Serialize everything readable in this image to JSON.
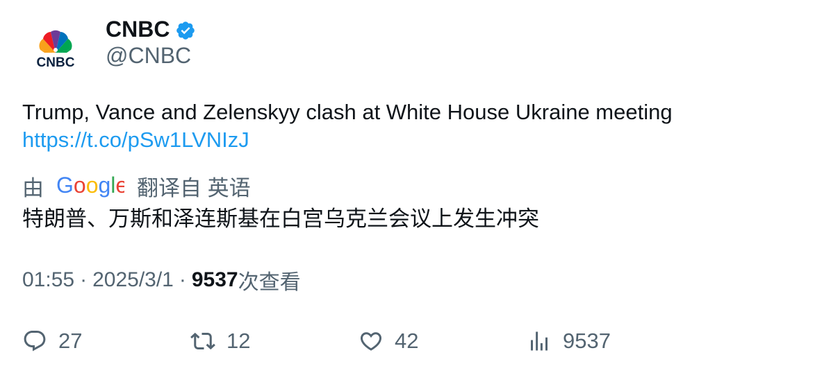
{
  "account": {
    "name": "CNBC",
    "handle": "@CNBC",
    "logo_text": "CNBC",
    "avatar_icon": "cnbc-peacock-logo",
    "verified_icon": "verified-badge-icon"
  },
  "tweet": {
    "text": "Trump, Vance and Zelenskyy clash at White House Ukraine meeting",
    "link": "https://t.co/pSw1LVNIzJ"
  },
  "translation": {
    "prefix": "由",
    "provider": "Google",
    "suffix": "翻译自 英语",
    "text": "特朗普、万斯和泽连斯基在白宫乌克兰会议上发生冲突"
  },
  "meta": {
    "time": "01:55",
    "separator": "·",
    "date": "2025/3/1",
    "views": "9537",
    "views_label": "次查看"
  },
  "actions": {
    "replies": "27",
    "retweets": "12",
    "likes": "42",
    "views": "9537"
  },
  "colors": {
    "text": "#0f1419",
    "secondary": "#536471",
    "link": "#1d9bf0"
  }
}
